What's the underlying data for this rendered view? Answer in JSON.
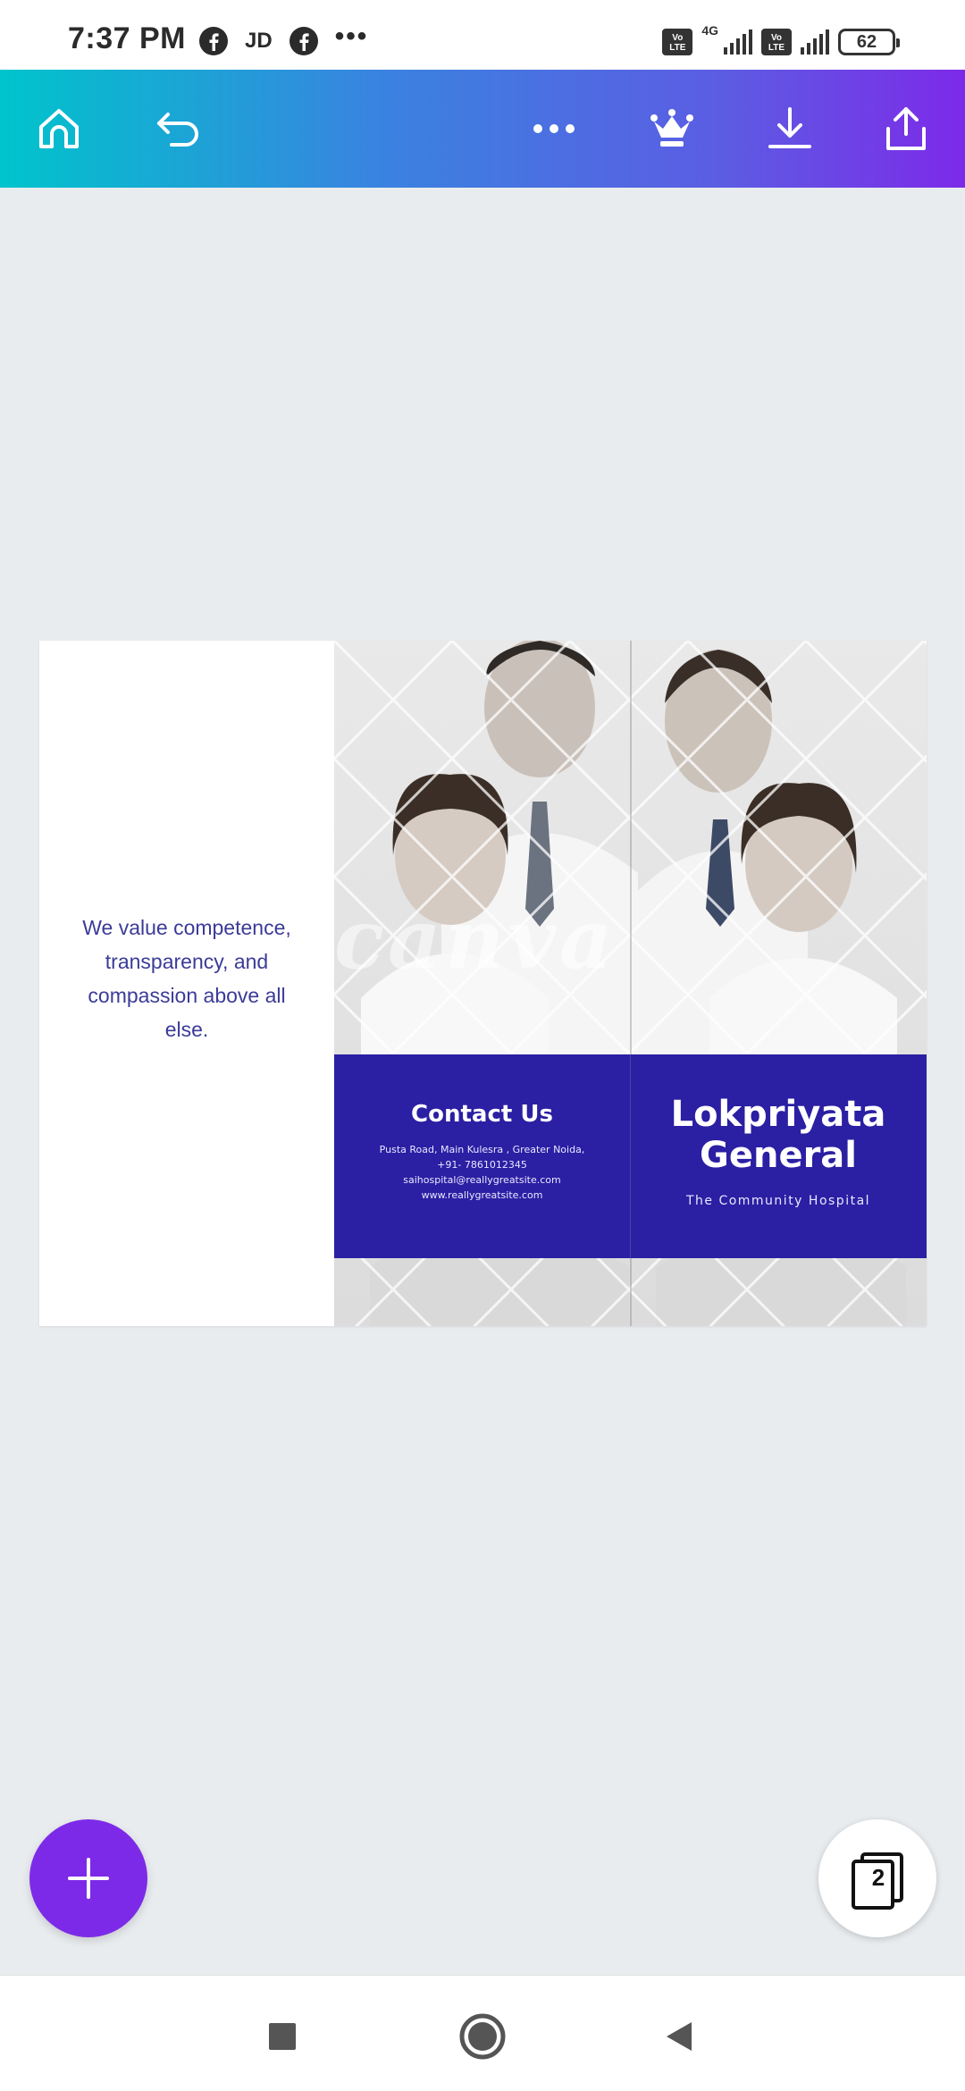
{
  "status_bar": {
    "time": "7:37 PM",
    "jd_label": "JD",
    "more": "•••",
    "net_label": "4G",
    "battery": "62",
    "icons": [
      "facebook-icon",
      "jd-icon",
      "facebook-icon",
      "more-icon",
      "volte-icon",
      "signal-icon",
      "volte-icon",
      "signal-icon",
      "battery-icon"
    ]
  },
  "toolbar": {
    "gradient": [
      "#00c4cc",
      "#3a82e0",
      "#7d2ae8"
    ],
    "icons": [
      "home-icon",
      "undo-icon",
      "more-options-icon",
      "crown-icon",
      "download-icon",
      "share-icon"
    ]
  },
  "design": {
    "tagline": "We value competence, transparency, and compassion above all else.",
    "watermark": "canva",
    "contact": {
      "title": "Contact Us",
      "address": "Pusta Road, Main Kulesra , Greater Noida,",
      "phone": "+91- 7861012345",
      "email": "saihospital@reallygreatsite.com",
      "website": "www.reallygreatsite.com"
    },
    "brand": {
      "title_line1": "Lokpriyata",
      "title_line2": "General",
      "subtitle": "The Community Hospital"
    },
    "colors": {
      "band": "#2b1fa3",
      "tagline": "#3b3b99"
    }
  },
  "floating": {
    "add_icon": "plus-icon",
    "pages_count": "2",
    "add_color": "#7d2ae8"
  },
  "nav_bar": {
    "icons": [
      "recents-square-icon",
      "home-circle-icon",
      "back-triangle-icon"
    ]
  }
}
